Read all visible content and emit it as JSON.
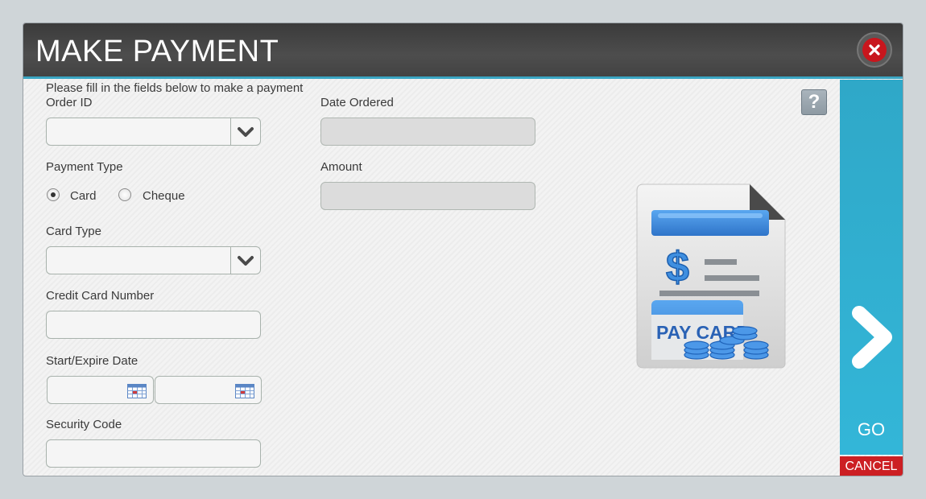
{
  "dialog": {
    "title": "MAKE PAYMENT",
    "instructions": "Please fill in the fields below to make a payment",
    "help_label": "?"
  },
  "fields": {
    "order_id": {
      "label": "Order ID",
      "value": ""
    },
    "date_ordered": {
      "label": "Date Ordered",
      "value": ""
    },
    "payment_type": {
      "label": "Payment Type",
      "options": [
        "Card",
        "Cheque"
      ],
      "selected": "Card"
    },
    "amount": {
      "label": "Amount",
      "value": ""
    },
    "card_type": {
      "label": "Card Type",
      "value": ""
    },
    "credit_card_number": {
      "label": "Credit Card Number",
      "value": ""
    },
    "start_expire_date": {
      "label": "Start/Expire Date",
      "start_value": "",
      "expire_value": ""
    },
    "security_code": {
      "label": "Security Code",
      "value": ""
    }
  },
  "illustration": {
    "text": "PAY CARD"
  },
  "actions": {
    "go_label": "GO",
    "cancel_label": "CANCEL"
  },
  "icons": {
    "close": "close-icon",
    "help": "help-icon",
    "dropdown": "chevron-down-icon",
    "calendar": "calendar-icon",
    "go": "chevron-right-icon",
    "illustration": "pay-card-document-icon"
  },
  "colors": {
    "titlebar": "#444444",
    "accent": "#33b6d8",
    "close": "#c8161d",
    "cancel": "#cc1f23"
  }
}
